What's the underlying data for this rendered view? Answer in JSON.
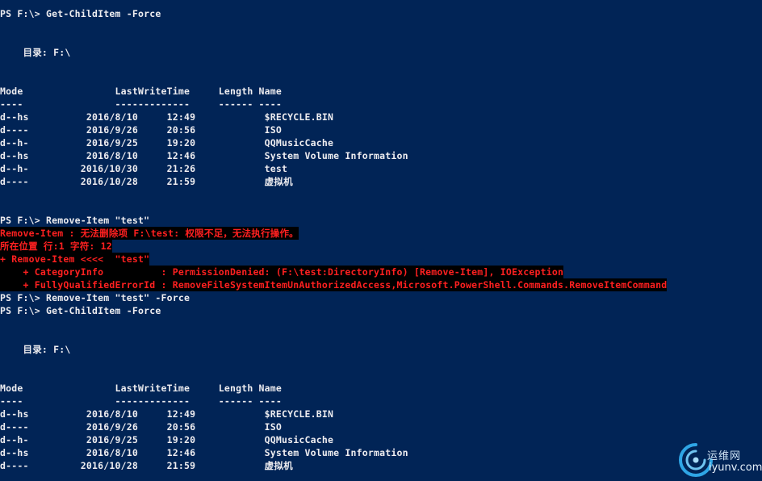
{
  "console": {
    "lines": [
      {
        "text": "PS F:\\> Get-ChildItem -Force",
        "style": "normal"
      },
      {
        "text": "",
        "style": "normal"
      },
      {
        "text": "",
        "style": "normal"
      },
      {
        "text": "    目录: F:\\",
        "style": "heading"
      },
      {
        "text": "",
        "style": "normal"
      },
      {
        "text": "",
        "style": "normal"
      },
      {
        "text": "Mode                LastWriteTime     Length Name",
        "style": "normal"
      },
      {
        "text": "----                -------------     ------ ----",
        "style": "normal"
      },
      {
        "text": "d--hs          2016/8/10     12:49            $RECYCLE.BIN",
        "style": "normal"
      },
      {
        "text": "d----          2016/9/26     20:56            ISO",
        "style": "normal"
      },
      {
        "text": "d--h-          2016/9/25     19:20            QQMusicCache",
        "style": "normal"
      },
      {
        "text": "d--hs          2016/8/10     12:46            System Volume Information",
        "style": "normal"
      },
      {
        "text": "d--h-         2016/10/30     21:26            test",
        "style": "normal"
      },
      {
        "text": "d----         2016/10/28     21:59            虚拟机",
        "style": "normal"
      },
      {
        "text": "",
        "style": "normal"
      },
      {
        "text": "",
        "style": "normal"
      },
      {
        "text": "PS F:\\> Remove-Item \"test\"",
        "style": "normal"
      },
      {
        "text": "Remove-Item : 无法删除项 F:\\test: 权限不足，无法执行操作。",
        "style": "error"
      },
      {
        "text": "所在位置 行:1 字符: 12",
        "style": "error"
      },
      {
        "text": "+ Remove-Item <<<<  \"test\"",
        "style": "error"
      },
      {
        "text": "    + CategoryInfo          : PermissionDenied: (F:\\test:DirectoryInfo) [Remove-Item], IOException",
        "style": "error"
      },
      {
        "text": "    + FullyQualifiedErrorId : RemoveFileSystemItemUnAuthorizedAccess,Microsoft.PowerShell.Commands.RemoveItemCommand",
        "style": "error"
      },
      {
        "text": "PS F:\\> Remove-Item \"test\" -Force",
        "style": "normal"
      },
      {
        "text": "PS F:\\> Get-ChildItem -Force",
        "style": "normal"
      },
      {
        "text": "",
        "style": "normal"
      },
      {
        "text": "",
        "style": "normal"
      },
      {
        "text": "    目录: F:\\",
        "style": "heading"
      },
      {
        "text": "",
        "style": "normal"
      },
      {
        "text": "",
        "style": "normal"
      },
      {
        "text": "Mode                LastWriteTime     Length Name",
        "style": "normal"
      },
      {
        "text": "----                -------------     ------ ----",
        "style": "normal"
      },
      {
        "text": "d--hs          2016/8/10     12:49            $RECYCLE.BIN",
        "style": "normal"
      },
      {
        "text": "d----          2016/9/26     20:56            ISO",
        "style": "normal"
      },
      {
        "text": "d--h-          2016/9/25     19:20            QQMusicCache",
        "style": "normal"
      },
      {
        "text": "d--hs          2016/8/10     12:46            System Volume Information",
        "style": "normal"
      },
      {
        "text": "d----         2016/10/28     21:59            虚拟机",
        "style": "normal"
      }
    ]
  },
  "watermark": {
    "cn_text": "运维网",
    "url_text": "iyunv.com"
  },
  "colors": {
    "background": "#012456",
    "foreground": "#eeedf0",
    "error_foreground": "#ff2020",
    "error_background": "#000000"
  }
}
